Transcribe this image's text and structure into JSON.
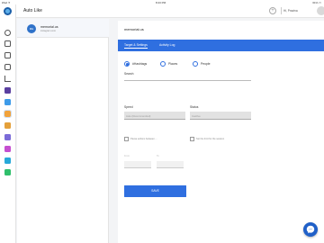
{
  "status_bar": {
    "left": "iPad ✈",
    "time": "8:43 PM",
    "right": "61% ▭"
  },
  "header": {
    "title": "Auto Like",
    "add_label": "+",
    "greeting": "Hi, Pravina"
  },
  "sidebar_icons": [
    "menu-icon",
    "home-icon",
    "grid-icon",
    "instagram-icon",
    "stats-icon",
    "contacts-icon",
    "messages-icon",
    "autolike-icon",
    "hashtag-icon",
    "comment-icon",
    "follow-icon",
    "post-icon",
    "whatsapp-icon"
  ],
  "sidebar_colors": {
    "active": "#f1a33c",
    "accent": "#2f6fe0"
  },
  "account": {
    "initials": "ME",
    "name": "memorial.us",
    "handle": "instagram.com"
  },
  "panel": {
    "title": "memorial.us",
    "tabs": [
      "Target & Settings",
      "Activity Log"
    ],
    "radios": [
      {
        "label": "#Hashtags",
        "selected": true
      },
      {
        "label": "Places",
        "selected": false
      },
      {
        "label": "People",
        "selected": false
      }
    ],
    "search_label": "Search",
    "speed": {
      "label": "Speed",
      "value": "Auto (Recommended)"
    },
    "status": {
      "label": "Status",
      "value": "Inactive"
    },
    "checkbox_pause": "Pause actions between ...",
    "checkbox_limit": "Set the limit for the session",
    "from_label": "From",
    "to_label": "To",
    "save_label": "SAVE"
  },
  "colors": {
    "brand": "#2f6fe0",
    "fab": "#2060c8"
  }
}
